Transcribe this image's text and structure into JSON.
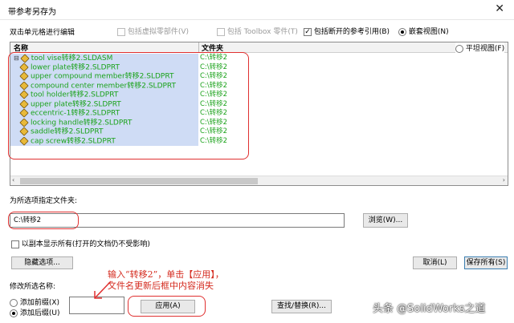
{
  "window": {
    "title": "带参考另存为",
    "close_glyph": "✕"
  },
  "options": {
    "hint": "双击单元格进行编辑",
    "include_virtual": "包括虚拟零部件(V)",
    "include_toolbox": "包括 Toolbox 零件(T)",
    "include_broken": "包括断开的参考引用(B)",
    "nested_view": "嵌套视图(N)",
    "flat_view": "平坦视图(F)"
  },
  "table": {
    "col_name": "名称",
    "col_folder": "文件夹",
    "rows": [
      {
        "name": "tool vise转移2.SLDASM",
        "folder": "C:\\转移2"
      },
      {
        "name": "lower plate转移2.SLDPRT",
        "folder": "C:\\转移2"
      },
      {
        "name": "upper compound member转移2.SLDPRT",
        "folder": "C:\\转移2"
      },
      {
        "name": "compound center member转移2.SLDPRT",
        "folder": "C:\\转移2"
      },
      {
        "name": "tool holder转移2.SLDPRT",
        "folder": "C:\\转移2"
      },
      {
        "name": "upper plate转移2.SLDPRT",
        "folder": "C:\\转移2"
      },
      {
        "name": "eccentric-1转移2.SLDPRT",
        "folder": "C:\\转移2"
      },
      {
        "name": "locking handle转移2.SLDPRT",
        "folder": "C:\\转移2"
      },
      {
        "name": "saddle转移2.SLDPRT",
        "folder": "C:\\转移2"
      },
      {
        "name": "cap screw转移2.SLDPRT",
        "folder": "C:\\转移2"
      }
    ]
  },
  "folder_section": {
    "label": "为所选项指定文件夹:",
    "path_value": "C:\\转移2",
    "browse": "浏览(W)..."
  },
  "readonly_option": "以副本显示所有(打开的文档仍不受影响)",
  "buttons": {
    "hide_options": "隐藏选项...",
    "cancel": "取消(L)",
    "save_all": "保存所有(S)",
    "apply": "应用(A)",
    "find_replace": "查找/替换(R)..."
  },
  "rename": {
    "label": "修改所选名称:",
    "add_prefix": "添加前缀(X)",
    "add_suffix": "添加后缀(U)",
    "value": ""
  },
  "annotation": {
    "line1": "输入“转移2”，单击【应用】，",
    "line2": "文件名更新后框中内容消失"
  },
  "watermark": "头条 @SolidWorks之道"
}
